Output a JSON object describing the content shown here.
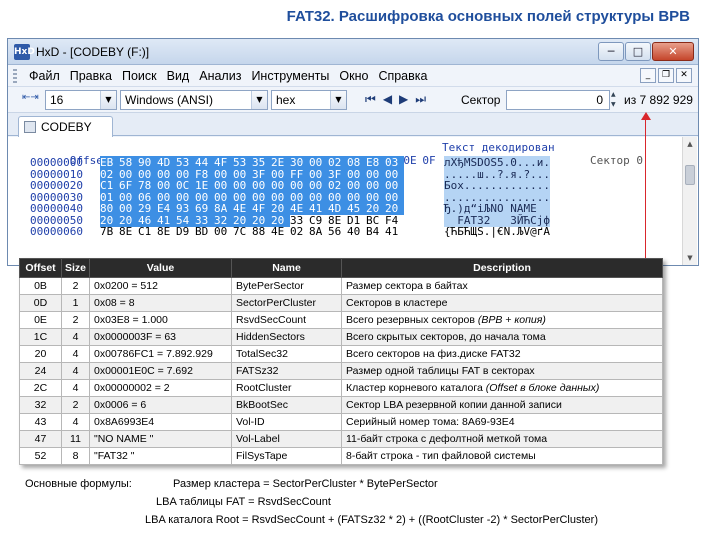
{
  "page_title": "FAT32. Расшифровка основных полей структуры BPB",
  "window": {
    "app_icon": "HxD",
    "title": "HxD - [CODEBY (F:)]",
    "buttons": {
      "minimize": "─",
      "maximize": "□",
      "close": "✕"
    }
  },
  "menu": [
    "Файл",
    "Правка",
    "Поиск",
    "Вид",
    "Анализ",
    "Инструменты",
    "Окно",
    "Справка"
  ],
  "mdi_buttons": [
    "_",
    "❐",
    "✕"
  ],
  "toolbar": {
    "bytes_per_row": "16",
    "charset": "Windows (ANSI)",
    "offset_base": "hex",
    "nav": [
      "⏮",
      "◀",
      "▶",
      "⏭"
    ],
    "sector_label": "Сектор",
    "sector_value": "0",
    "total": "из 7 892 929"
  },
  "tab": {
    "label": "CODEBY (F:)"
  },
  "hex": {
    "header_offset": "Offset(h)",
    "header_columns": [
      "00",
      "01",
      "02",
      "03",
      "04",
      "05",
      "06",
      "07",
      "08",
      "09",
      "0A",
      "0B",
      "0C",
      "0D",
      "0E",
      "0F"
    ],
    "header_text": "Текст декодирован",
    "sector_note": "Сектор 0",
    "rows": [
      {
        "offset": "00000000",
        "bytes": [
          "EB",
          "58",
          "90",
          "4D",
          "53",
          "44",
          "4F",
          "53",
          "35",
          "2E",
          "30",
          "00",
          "02",
          "08",
          "E8",
          "03"
        ],
        "text": "лXђMSDOS5.0...и."
      },
      {
        "offset": "00000010",
        "bytes": [
          "02",
          "00",
          "00",
          "00",
          "00",
          "F8",
          "00",
          "00",
          "3F",
          "00",
          "FF",
          "00",
          "3F",
          "00",
          "00",
          "00"
        ],
        "text": ".....ш..?.я.?..."
      },
      {
        "offset": "00000020",
        "bytes": [
          "C1",
          "6F",
          "78",
          "00",
          "0C",
          "1E",
          "00",
          "00",
          "00",
          "00",
          "00",
          "00",
          "02",
          "00",
          "00",
          "00"
        ],
        "text": "Бох............."
      },
      {
        "offset": "00000030",
        "bytes": [
          "01",
          "00",
          "06",
          "00",
          "00",
          "00",
          "00",
          "00",
          "00",
          "00",
          "00",
          "00",
          "00",
          "00",
          "00",
          "00"
        ],
        "text": "................"
      },
      {
        "offset": "00000040",
        "bytes": [
          "80",
          "00",
          "29",
          "E4",
          "93",
          "69",
          "8A",
          "4E",
          "4F",
          "20",
          "4E",
          "41",
          "4D",
          "45",
          "20",
          "20"
        ],
        "text": "Ђ.)д“iЉNO NAME  "
      },
      {
        "offset": "00000050",
        "bytes": [
          "20",
          "20",
          "46",
          "41",
          "54",
          "33",
          "32",
          "20",
          "20",
          "20",
          "33",
          "C9",
          "8E",
          "D1",
          "BC",
          "F4"
        ],
        "text": "  FAT32   3ЙЋСјф"
      },
      {
        "offset": "00000060",
        "bytes": [
          "7B",
          "8E",
          "C1",
          "8E",
          "D9",
          "BD",
          "00",
          "7C",
          "88",
          "4E",
          "02",
          "8A",
          "56",
          "40",
          "B4",
          "41"
        ],
        "text": "{ЋБЋЩЅ.|€N.ЉV@ґA"
      }
    ]
  },
  "table": {
    "headers": [
      "Offset",
      "Size",
      "Value",
      "Name",
      "Description"
    ],
    "rows": [
      [
        "0B",
        "2",
        "0x0200 = 512",
        "BytePerSector",
        "Размер сектора в байтах"
      ],
      [
        "0D",
        "1",
        "0x08 = 8",
        "SectorPerCluster",
        "Секторов в кластере"
      ],
      [
        "0E",
        "2",
        "0x03E8 = 1.000",
        "RsvdSecCount",
        "Всего резервных секторов (ВРВ + копия)"
      ],
      [
        "1C",
        "4",
        "0x0000003F = 63",
        "HiddenSectors",
        "Всего скрытых секторов, до начала тома"
      ],
      [
        "20",
        "4",
        "0x00786FC1 = 7.892.929",
        "TotalSec32",
        "Всего секторов на физ.диске FAT32"
      ],
      [
        "24",
        "4",
        "0x00001E0C = 7.692",
        "FATSz32",
        "Размер одной таблицы FAT в секторах"
      ],
      [
        "2C",
        "4",
        "0x00000002 = 2",
        "RootCluster",
        "Кластер корневого каталога  (Offset в блоке данных)"
      ],
      [
        "32",
        "2",
        "0x0006 = 6",
        "BkBootSec",
        "Сектор LBA резервной копии данной записи"
      ],
      [
        "43",
        "4",
        "0x8A6993E4",
        "Vol-ID",
        "Серийный номер тома:  8A69-93E4"
      ],
      [
        "47",
        "11",
        "\"NO NAME    \"",
        "Vol-Label",
        "11-байт строка с дефолтной меткой тома"
      ],
      [
        "52",
        "8",
        "\"FAT32   \"",
        "FilSysTape",
        "   8-байт строка - тип файловой системы"
      ]
    ]
  },
  "formulas": {
    "heading": "Основные формулы:",
    "line1": "Размер кластера  =  SectorPerCluster * BytePerSector",
    "line2": "LBA таблицы FAT  =  RsvdSecCount",
    "line3": "LBA каталога Root  =  RsvdSecCount + (FATSz32 * 2) + ((RootCluster -2) * SectorPerCluster)"
  }
}
